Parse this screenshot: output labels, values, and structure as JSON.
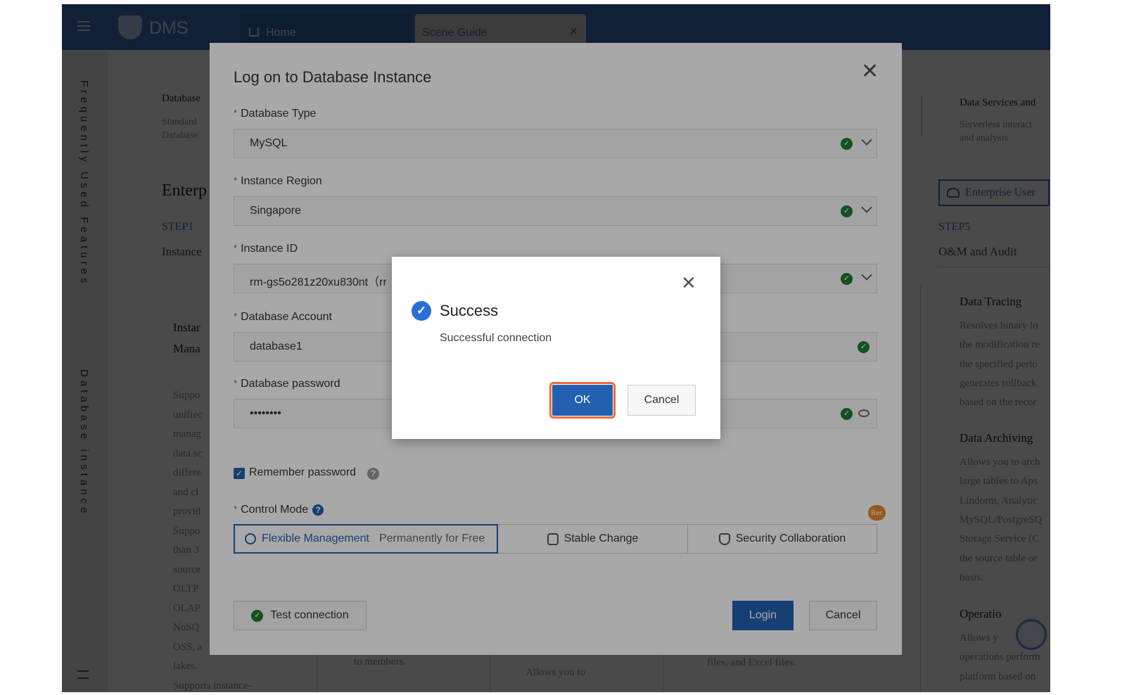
{
  "header": {
    "brand": "DMS",
    "tabs": [
      {
        "label": "Home",
        "icon": "home-icon"
      },
      {
        "label": "Scene Guide",
        "close": "×"
      }
    ]
  },
  "sidebar": {
    "sections": [
      "Frequently Used Features",
      "Database instance"
    ]
  },
  "background": {
    "left": {
      "card_title": "Database",
      "card_lines": [
        "Standard",
        "Database"
      ],
      "heading": "Enterp",
      "step": "STEP1",
      "step_title": "Instance",
      "feature_title": [
        "Instar",
        "Mana"
      ],
      "body": [
        "Suppo",
        "unifiec",
        "manag",
        "data sc",
        "differe",
        "and cl",
        "provid",
        "Suppo",
        "than 3",
        "source",
        "OLTP",
        "OLAP",
        "NoSQ",
        "OSS, a",
        "lakes.",
        "Supports instance-"
      ]
    },
    "middle": [
      "to members.",
      "Allows you to",
      "files, and Excel files."
    ],
    "right": {
      "card_title": "Data Services and",
      "card_lines": [
        "Serverless interact",
        "and analysis"
      ],
      "enterprise_button": "Enterprise User",
      "step": "STEP5",
      "step_title": "O&M and Audit",
      "sections": [
        {
          "title": "Data Tracing",
          "lines": [
            "Resolves binary lo",
            "the modification re",
            "the specified perio",
            "generates rollback",
            "based on the recor"
          ]
        },
        {
          "title": "Data Archiving",
          "lines": [
            "Allows you to arch",
            "large tables to Aps",
            "Lindorm, Analytic",
            "MySQL/PostgreSQ",
            "Storage Service (C",
            "the source table or",
            "basis."
          ]
        },
        {
          "title": "Operatio",
          "lines": [
            "Allows y",
            "operations perform",
            "platform based on"
          ]
        }
      ]
    }
  },
  "modal": {
    "title": "Log on to Database Instance",
    "fields": [
      {
        "label": "Database Type",
        "value": "MySQL",
        "status": "valid"
      },
      {
        "label": "Instance Region",
        "value": "Singapore",
        "status": "valid"
      },
      {
        "label": "Instance ID",
        "value": "rm-gs5o281z20xu830nt（rr",
        "status": "valid"
      },
      {
        "label": "Database Account",
        "value": "database1",
        "status": "valid"
      },
      {
        "label": "Database password",
        "value": "••••••••",
        "status": "valid"
      }
    ],
    "remember_password": {
      "label": "Remember password",
      "checked": true
    },
    "control_mode": {
      "label": "Control Mode",
      "options": [
        {
          "label": "Flexible Management",
          "note": "Permanently for Free",
          "selected": true
        },
        {
          "label": "Stable Change"
        },
        {
          "label": "Security Collaboration",
          "badge": "Rec"
        }
      ]
    },
    "test_connection": "Test connection",
    "login": "Login",
    "cancel": "Cancel"
  },
  "dialog": {
    "title": "Success",
    "message": "Successful connection",
    "ok": "OK",
    "cancel": "Cancel"
  },
  "colors": {
    "primary": "#2260b0",
    "success": "#1e7b34",
    "focus_ring": "#f06a35",
    "badge": "#e08a2a"
  }
}
